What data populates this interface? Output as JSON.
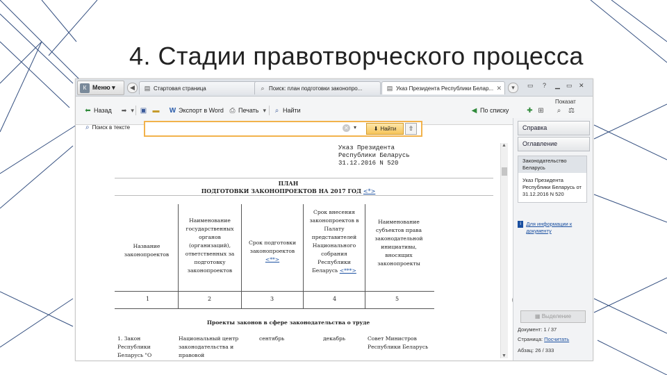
{
  "slide": {
    "title": "4. Стадии правотворческого процесса"
  },
  "colors": {
    "accent": "#f2b24b",
    "link": "#1a4fa0",
    "deco": "#1f3d73"
  },
  "tabs": {
    "menu_label": "Меню ▾",
    "items": [
      {
        "label": "Стартовая страница"
      },
      {
        "label": "Поиск: план подготовки законопро..."
      },
      {
        "label": "Указ Президента Республики Белар..."
      }
    ]
  },
  "toolbar": {
    "back": "Назад",
    "export_word": "Экспорт в Word",
    "print": "Печать",
    "find": "Найти",
    "by_list": "По списку",
    "show": "Показат"
  },
  "search": {
    "label": "Поиск в тексте",
    "value": "",
    "find_button": "Найти"
  },
  "document": {
    "header_lines": [
      "Указ Президента",
      "Республики Беларусь",
      "31.12.2016 N 520"
    ],
    "plan_title": "ПЛАН",
    "plan_subtitle": "ПОДГОТОВКИ ЗАКОНОПРОЕКТОВ НА 2017 ГОД",
    "plan_ref": "<*>",
    "columns": [
      "Название законопроектов",
      "Наименование государственных органов (организаций), ответственных за подготовку законопроектов",
      "Срок подготовки законопроектов",
      "Срок внесения законопроектов в Палату представителей Национального собрания Республики Беларусь",
      "Наименование субъектов права законодательной инициативы, вносящих законопроекты"
    ],
    "col3_ref": "<**>",
    "col4_ref": "<***>",
    "col_numbers": [
      "1",
      "2",
      "3",
      "4",
      "5"
    ],
    "section": "Проекты законов в сфере законодательства о труде",
    "first_row": {
      "c1": "1. Закон Республики Беларусь \"О",
      "c2": "Национальный центр законодательства и правовой",
      "c3": "сентябрь",
      "c4": "декабрь",
      "c5": "Совет Министров Республики Беларусь"
    }
  },
  "right_panel": {
    "spravka": "Справка",
    "oglavlenie": "Оглавление",
    "box_header": "Законодательство Беларусь",
    "box_body": "Указ Президента Республики Беларусь от 31.12.2016 N 520",
    "doc_info_link": "Для информации к документу",
    "highlight_button": "Выделение",
    "doc_label": "Документ:",
    "doc_value": "1 / 37",
    "page_label": "Страница:",
    "page_link": "Посчитать",
    "para_label": "Абзац:",
    "para_value": "26 / 333"
  }
}
